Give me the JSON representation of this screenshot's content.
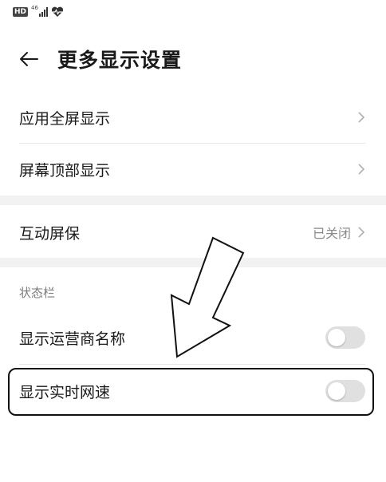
{
  "status_bar": {
    "hd": "HD",
    "network": "46"
  },
  "header": {
    "title": "更多显示设置"
  },
  "rows": [
    {
      "label": "应用全屏显示"
    },
    {
      "label": "屏幕顶部显示"
    },
    {
      "label": "互动屏保",
      "value": "已关闭"
    }
  ],
  "section": {
    "title": "状态栏",
    "toggles": [
      {
        "label": "显示运营商名称",
        "on": false
      },
      {
        "label": "显示实时网速",
        "on": false
      }
    ]
  }
}
